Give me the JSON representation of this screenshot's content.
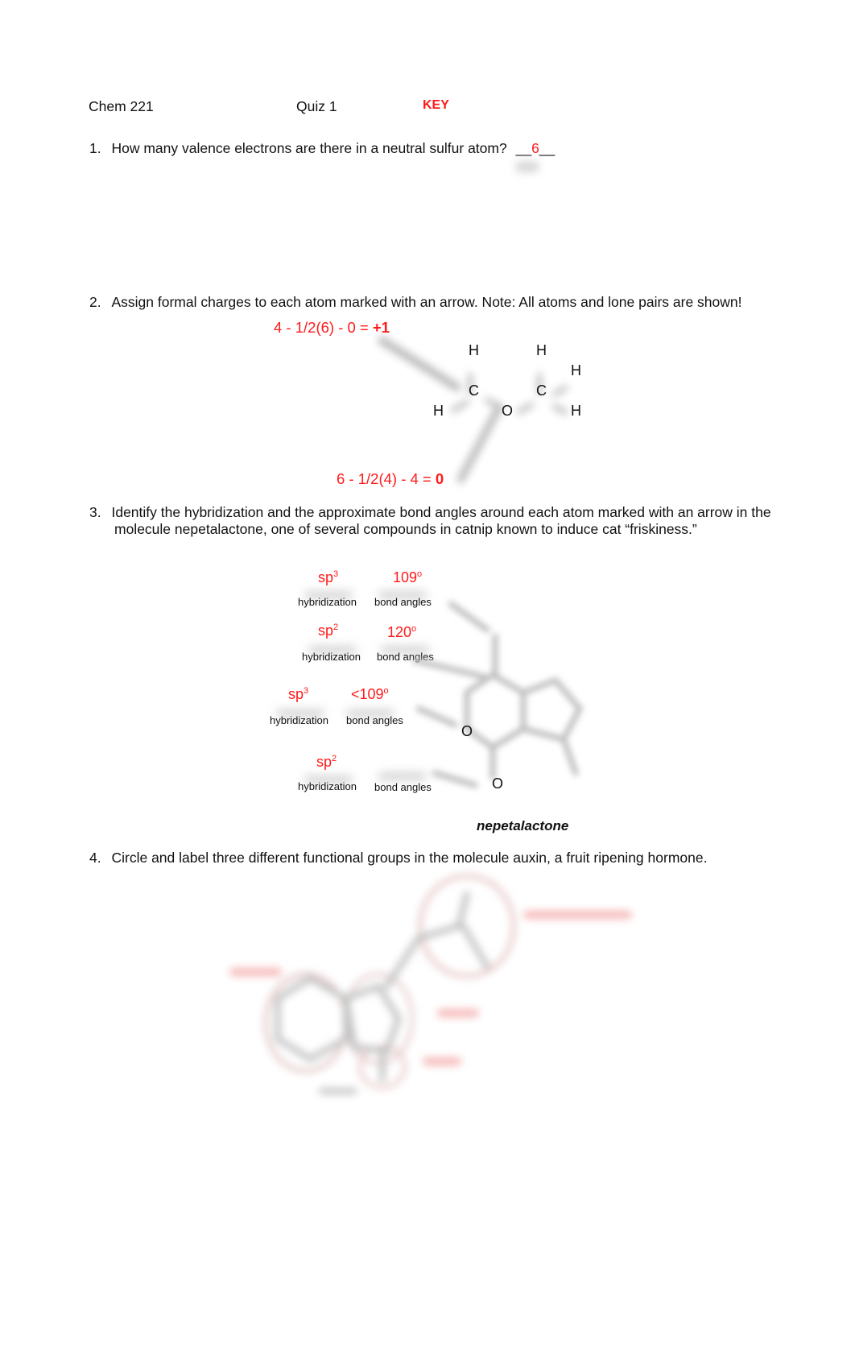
{
  "header": {
    "course": "Chem 221",
    "quiz": "Quiz 1",
    "key": "KEY"
  },
  "questions": [
    {
      "number": "1.",
      "text": "How many valence electrons are there in a neutral sulfur atom?",
      "blank_left": "__",
      "answer": "6",
      "blank_right": "__"
    },
    {
      "number": "2.",
      "text": "Assign formal charges to each atom marked with an arrow.  Note:  All atoms and lone pairs are shown!",
      "formulas": [
        {
          "expr": "4 - 1/2(6) - 0 = ",
          "result": "+1"
        },
        {
          "expr": "6 - 1/2(4) - 4 = ",
          "result": "0"
        }
      ],
      "atoms": [
        "H",
        "H",
        "H",
        "C",
        "C",
        "H",
        "O",
        "H"
      ]
    },
    {
      "number": "3.",
      "text_line1": "Identify the hybridization and the approximate bond angles around each atom marked with an arrow in the",
      "text_line2": "molecule nepetalactone, one of several compounds in catnip known to induce cat “friskiness.”",
      "answers": [
        {
          "hyb_base": "sp",
          "hyb_sup": "3",
          "angle": "109",
          "angle_sup": "o",
          "hyb_label": "hybridization",
          "angle_label": "bond angles"
        },
        {
          "hyb_base": "sp",
          "hyb_sup": "2",
          "angle": "120",
          "angle_sup": "o",
          "hyb_label": "hybridization",
          "angle_label": "bond angles"
        },
        {
          "hyb_base": "sp",
          "hyb_sup": "3",
          "angle": "<109",
          "angle_sup": "o",
          "hyb_label": "hybridization",
          "angle_label": "bond angles"
        },
        {
          "hyb_base": "sp",
          "hyb_sup": "2",
          "angle": "",
          "angle_sup": "",
          "hyb_label": "hybridization",
          "angle_label": "bond angles"
        }
      ],
      "atoms": [
        "O",
        "O"
      ],
      "molecule_name": "nepetalactone"
    },
    {
      "number": "4.",
      "text": "Circle and label three different functional groups in the molecule auxin, a fruit ripening hormone."
    }
  ]
}
